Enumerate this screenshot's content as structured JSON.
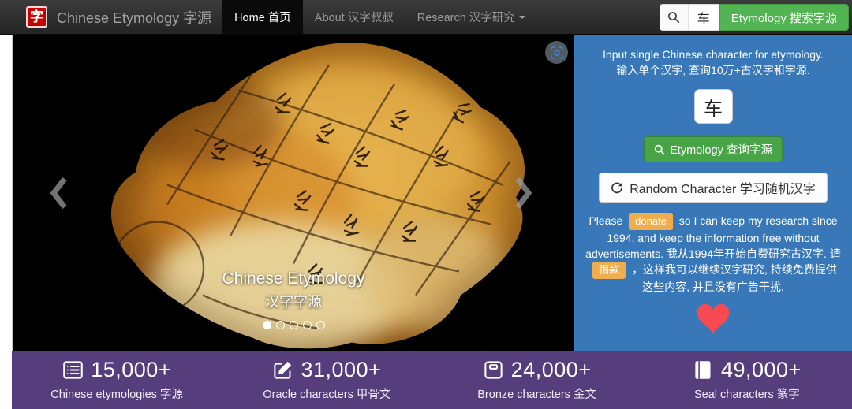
{
  "navbar": {
    "logo_char": "字",
    "brand": "Chinese Etymology 字源",
    "tabs": [
      {
        "label": "Home 首页",
        "active": true
      },
      {
        "label": "About 汉字叔叔",
        "active": false
      },
      {
        "label": "Research 汉字研究",
        "active": false,
        "has_caret": true
      }
    ],
    "search_value": "车",
    "search_button": "Etymology 搜索字源"
  },
  "carousel": {
    "caption_title": "Chinese Etymology",
    "caption_subtitle": "汉字字源",
    "dot_count": 5,
    "active_dot": 0
  },
  "panel": {
    "instruction_en": "Input single Chinese character for etymology.",
    "instruction_zh": "输入单个汉字, 查询10万+古汉字和字源.",
    "input_value": "车",
    "etymology_button": "Etymology 查询字源",
    "random_button": "Random Character 学习随机汉字",
    "donate_before_en": "Please",
    "donate_badge_en": "donate",
    "donate_after_en": "so I can keep my research since 1994, and keep the information free without advertisements.",
    "donate_before_zh": "我从1994年开始自费研究古汉字. 请",
    "donate_badge_zh": "捐款",
    "donate_after_zh": "，这样我可以继续汉字研究, 持续免费提供这些内容, 并且没有广告干扰."
  },
  "stats": [
    {
      "icon": "list-icon",
      "value": "15,000+",
      "label": "Chinese etymologies 字源"
    },
    {
      "icon": "edit-icon",
      "value": "31,000+",
      "label": "Oracle characters 甲骨文"
    },
    {
      "icon": "save-icon",
      "value": "24,000+",
      "label": "Bronze characters 金文"
    },
    {
      "icon": "book-icon",
      "value": "49,000+",
      "label": "Seal characters 篆字"
    }
  ],
  "colors": {
    "navbar_bg": "#2b2b2b",
    "accent_green": "#47a447",
    "panel_blue": "#3878b8",
    "stats_purple": "#563d7c",
    "badge_orange": "#f0ad4e",
    "heart_red": "#f84a50",
    "logo_red": "#c70000"
  }
}
